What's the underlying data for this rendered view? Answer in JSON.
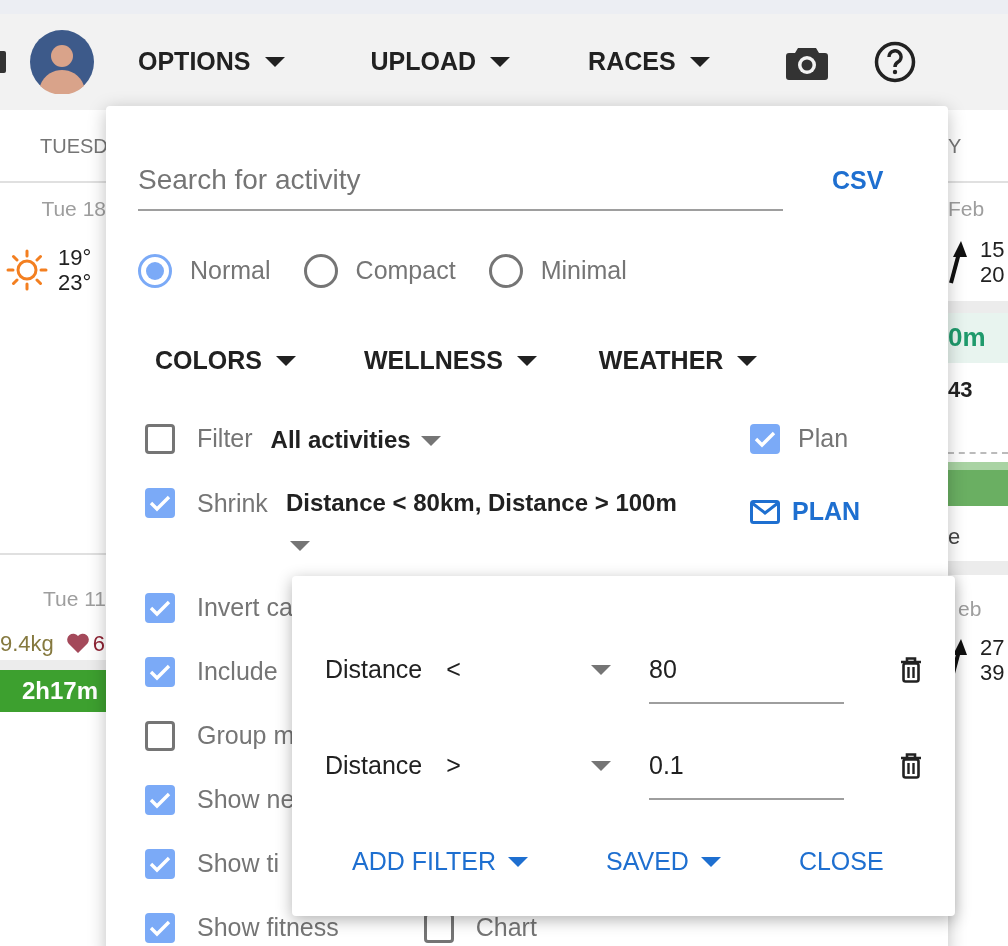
{
  "top_bar": {
    "menus": [
      {
        "label": "OPTIONS"
      },
      {
        "label": "UPLOAD"
      },
      {
        "label": "RACES"
      }
    ]
  },
  "calendar": {
    "left": {
      "header": "TUESD",
      "days": [
        {
          "date": "Tue 18",
          "temps": [
            "19°",
            "23°"
          ]
        },
        {
          "date": "Tue 11",
          "weight": "9.4kg",
          "heart_rate": "6",
          "activity": "2h17m"
        }
      ]
    },
    "right": {
      "header": "Y",
      "days": [
        {
          "date": "Feb",
          "temps": [
            "15",
            "20"
          ],
          "activity": "0m",
          "stat": "43",
          "note": "e"
        },
        {
          "date": "eb",
          "temps": [
            "27",
            "39"
          ]
        }
      ]
    }
  },
  "options_menu": {
    "search": {
      "placeholder": "Search for activity"
    },
    "csv_button": "CSV",
    "layouts": [
      {
        "label": "Normal",
        "selected": true
      },
      {
        "label": "Compact",
        "selected": false
      },
      {
        "label": "Minimal",
        "selected": false
      }
    ],
    "dropdowns": [
      "COLORS",
      "WELLNESS",
      "WEATHER"
    ],
    "options": [
      {
        "label": "Filter",
        "checked": false,
        "value": "All activities"
      },
      {
        "label": "Shrink",
        "checked": true,
        "value": "Distance < 80km, Distance > 100m"
      },
      {
        "label": "Invert ca",
        "checked": true
      },
      {
        "label": "Include",
        "checked": true
      },
      {
        "label": "Group m",
        "checked": false
      },
      {
        "label": "Show ne",
        "checked": true
      },
      {
        "label": "Show ti",
        "checked": true
      },
      {
        "label": "Show fitness",
        "checked": true,
        "extra": {
          "label": "Chart",
          "checked": false
        }
      }
    ],
    "plan_checkbox": {
      "label": "Plan",
      "checked": true
    },
    "plan_buttons": [
      {
        "label": "PLAN",
        "kind": "mail"
      }
    ]
  },
  "filter_popup": {
    "rows": [
      {
        "field": "Distance",
        "operator": "<",
        "value": "80"
      },
      {
        "field": "Distance",
        "operator": ">",
        "value": "0.1"
      }
    ],
    "buttons": [
      {
        "label": "ADD FILTER",
        "dropdown": true
      },
      {
        "label": "SAVED",
        "dropdown": true
      },
      {
        "label": "CLOSE",
        "dropdown": false
      }
    ]
  }
}
